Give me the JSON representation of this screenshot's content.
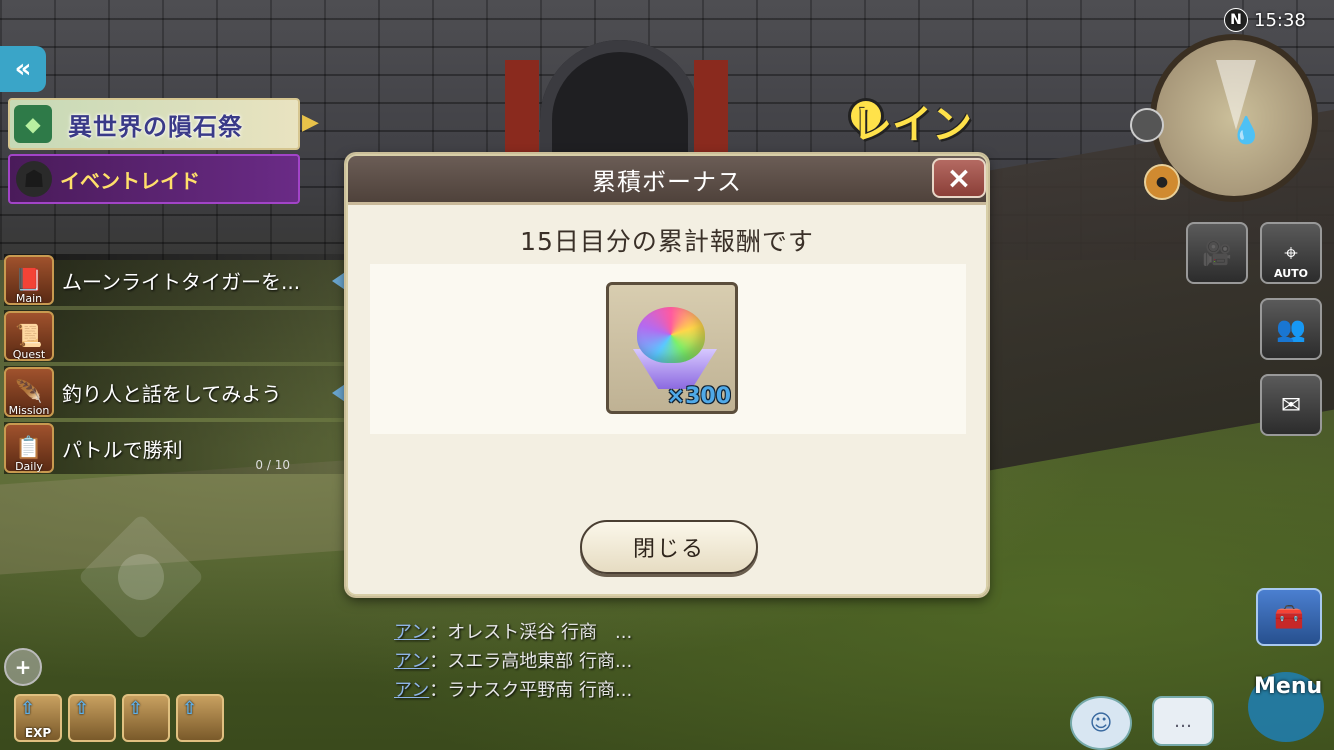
{
  "status_bar": {
    "compass": "N",
    "time": "15:38"
  },
  "hud_left": {
    "back_icon": "double-chevron-left",
    "event_banner": "異世界の隕石祭",
    "event_raid": "イベントレイド",
    "quests": [
      {
        "tag": "Main",
        "text": "ムーンライトタイガーを...",
        "progress": ""
      },
      {
        "tag": "Quest",
        "text": "",
        "progress": ""
      },
      {
        "tag": "Mission",
        "text": "釣り人と話をしてみよう",
        "progress": ""
      },
      {
        "tag": "Daily",
        "text": "パトルで勝利",
        "progress": "0 / 10"
      }
    ],
    "boost_labels": [
      "EXP",
      "",
      "",
      ""
    ]
  },
  "location_label": "レイン",
  "hud_right": {
    "camera_auto_label": "AUTO",
    "menu_label": "Menu"
  },
  "chat_log": [
    {
      "speaker": "アン",
      "message": "：オレスト渓谷 行商　..."
    },
    {
      "speaker": "アン",
      "message": "：スエラ高地東部 行商..."
    },
    {
      "speaker": "アン",
      "message": "：ラナスク平野南 行商..."
    }
  ],
  "modal": {
    "title": "累積ボーナス",
    "close_icon": "×",
    "subtitle": "15日目分の累計報酬です",
    "reward": {
      "item": "rainbow-gem",
      "quantity": "×300"
    },
    "close_button": "閉じる"
  }
}
